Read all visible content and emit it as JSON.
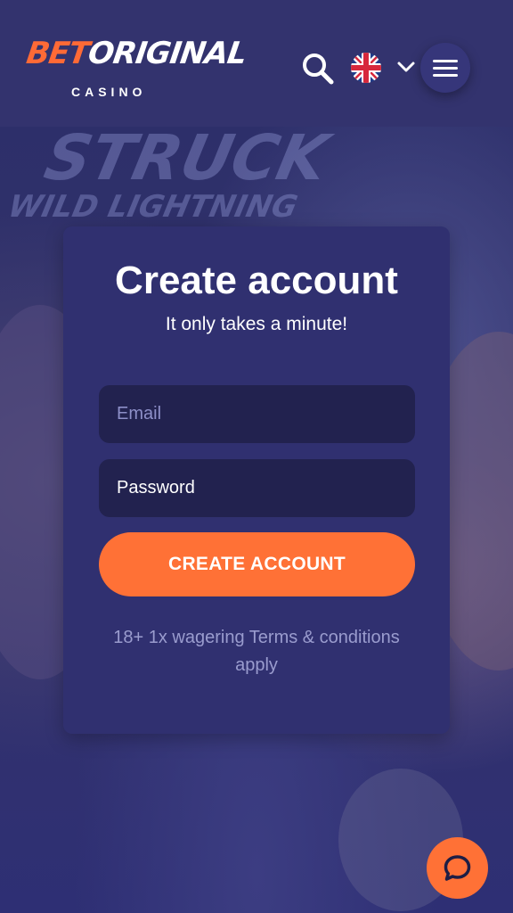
{
  "header": {
    "logo": {
      "brand_left": "BET",
      "brand_right": "ORIGINAL",
      "subtitle": "CASINO"
    },
    "icons": {
      "search": "search-icon",
      "language": "uk-flag-icon",
      "dropdown": "chevron-down-icon",
      "menu": "hamburger-menu-icon"
    }
  },
  "hero": {
    "background_text": [
      "STRUCK",
      "WILD LIGHTNING"
    ]
  },
  "signup": {
    "title": "Create account",
    "subtitle": "It only takes a minute!",
    "email_placeholder": "Email",
    "password_placeholder": "Password",
    "submit_label": "CREATE ACCOUNT",
    "terms_prefix": "18+ 1x wagering ",
    "terms_link": "Terms & conditions",
    "terms_suffix": " apply"
  },
  "chat": {
    "icon": "chat-bubble-icon"
  },
  "colors": {
    "header_bg": "#33336e",
    "card_bg": "#303070",
    "field_bg": "#22224f",
    "accent": "#ff7136"
  }
}
